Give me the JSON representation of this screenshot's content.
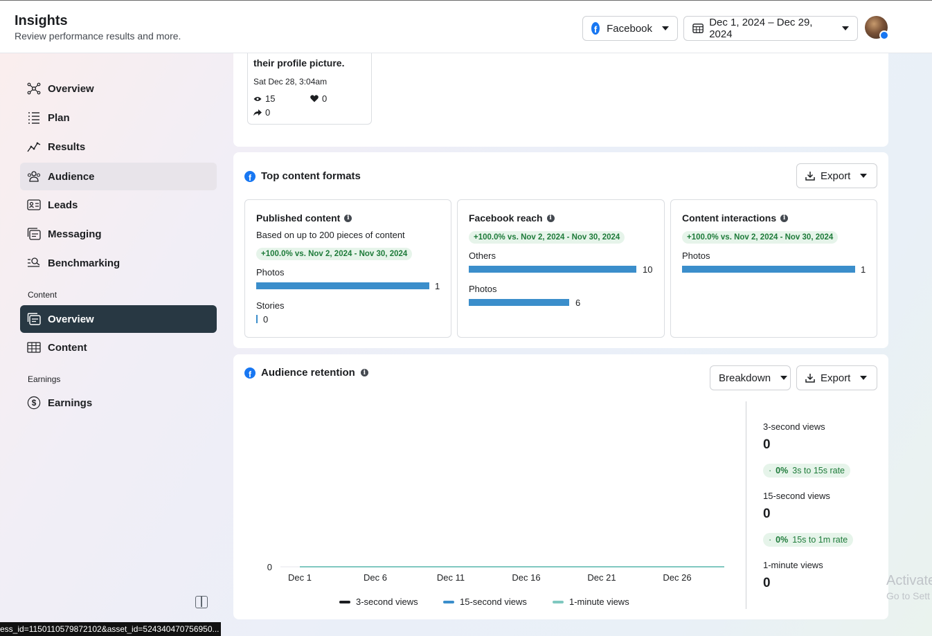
{
  "header": {
    "title": "Insights",
    "subtitle": "Review performance results and more.",
    "platform_label": "Facebook",
    "date_range": "Dec 1, 2024 – Dec 29, 2024"
  },
  "sidebar": {
    "items": [
      {
        "label": "Overview"
      },
      {
        "label": "Plan"
      },
      {
        "label": "Results"
      },
      {
        "label": "Audience"
      },
      {
        "label": "Leads"
      },
      {
        "label": "Messaging"
      },
      {
        "label": "Benchmarking"
      }
    ],
    "content_section": "Content",
    "content_items": [
      {
        "label": "Overview"
      },
      {
        "label": "Content"
      }
    ],
    "earnings_section": "Earnings",
    "earnings_items": [
      {
        "label": "Earnings"
      }
    ]
  },
  "post": {
    "title": "their profile picture.",
    "date": "Sat Dec 28, 3:04am",
    "views": "15",
    "reactions": "0",
    "shares": "0"
  },
  "top_formats": {
    "title": "Top content formats",
    "export_label": "Export",
    "published": {
      "title": "Published content",
      "desc": "Based on up to 200 pieces of content",
      "change": "+100.0% vs. Nov 2, 2024 - Nov 30, 2024",
      "rows": [
        {
          "label": "Photos",
          "value": "1"
        },
        {
          "label": "Stories",
          "value": "0"
        }
      ]
    },
    "reach": {
      "title": "Facebook reach",
      "change": "+100.0% vs. Nov 2, 2024 - Nov 30, 2024",
      "rows": [
        {
          "label": "Others",
          "value": "10"
        },
        {
          "label": "Photos",
          "value": "6"
        }
      ]
    },
    "interactions": {
      "title": "Content interactions",
      "change": "+100.0% vs. Nov 2, 2024 - Nov 30, 2024",
      "rows": [
        {
          "label": "Photos",
          "value": "1"
        }
      ]
    }
  },
  "retention": {
    "title": "Audience retention",
    "breakdown_label": "Breakdown",
    "export_label": "Export",
    "stats": {
      "three_label": "3-second views",
      "three_value": "0",
      "rate1_pct": "0%",
      "rate1_label": "3s to 15s rate",
      "fifteen_label": "15-second views",
      "fifteen_value": "0",
      "rate2_pct": "0%",
      "rate2_label": "15s to 1m rate",
      "minute_label": "1-minute views",
      "minute_value": "0"
    }
  },
  "chart_data": {
    "type": "line",
    "x": [
      "Dec 1",
      "Dec 6",
      "Dec 11",
      "Dec 16",
      "Dec 21",
      "Dec 26"
    ],
    "y_ticks": [
      "0"
    ],
    "series": [
      {
        "name": "3-second views",
        "color": "#1c1e21",
        "values": [
          0,
          0,
          0,
          0,
          0,
          0
        ]
      },
      {
        "name": "15-second views",
        "color": "#3b8ecb",
        "values": [
          0,
          0,
          0,
          0,
          0,
          0
        ]
      },
      {
        "name": "1-minute views",
        "color": "#7fc8c0",
        "values": [
          0,
          0,
          0,
          0,
          0,
          0
        ]
      }
    ],
    "ylim": [
      0,
      1
    ]
  },
  "watermark": {
    "line1": "Activate",
    "line2": "Go to Sett"
  },
  "status_url": "ess_id=1150110579872102&asset_id=524340470756950..."
}
